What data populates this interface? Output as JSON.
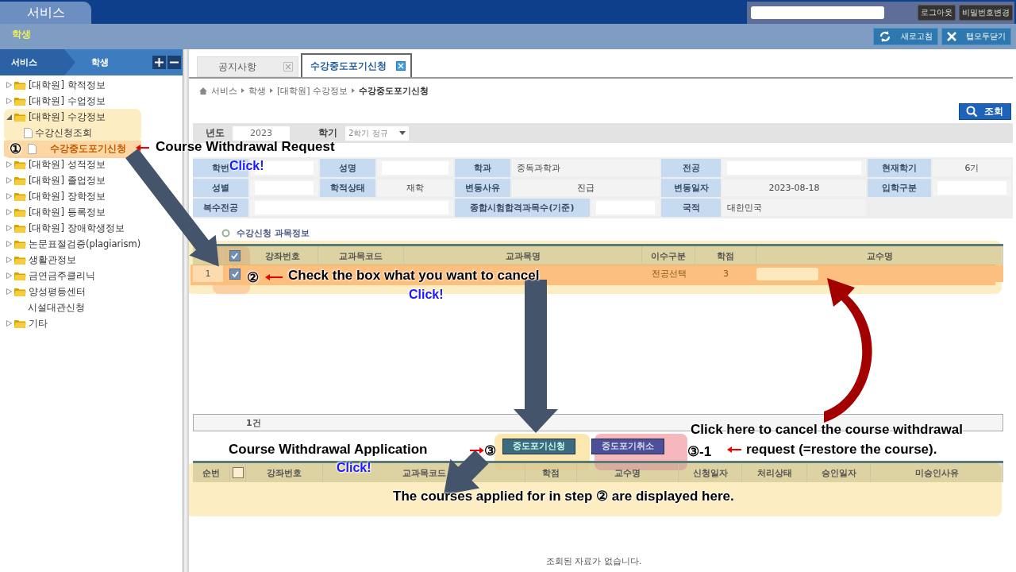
{
  "header": {
    "service_tab": "서비스",
    "buttons": [
      "로그아웃",
      "비밀번호변경"
    ]
  },
  "toolbar": {
    "title": "학생",
    "buttons": [
      {
        "label": "새로고침",
        "kind": "refresh"
      },
      {
        "label": "탭모두닫기",
        "kind": "close"
      }
    ]
  },
  "sidebar": {
    "path": [
      "서비스",
      "학생"
    ],
    "tree": [
      {
        "label": "[대학원] 학적정보",
        "kind": "folder",
        "expanded": false
      },
      {
        "label": "[대학원] 수업정보",
        "kind": "folder",
        "expanded": false
      },
      {
        "label": "[대학원] 수강정보",
        "kind": "folder",
        "expanded": true,
        "children": [
          {
            "label": "수강신청조회",
            "kind": "page",
            "selected": false
          },
          {
            "label": "수강중도포기신청",
            "kind": "page",
            "selected": true
          }
        ]
      },
      {
        "label": "[대학원] 성적정보",
        "kind": "folder",
        "expanded": false
      },
      {
        "label": "[대학원] 졸업정보",
        "kind": "folder",
        "expanded": false
      },
      {
        "label": "[대학원] 장학정보",
        "kind": "folder",
        "expanded": false
      },
      {
        "label": "[대학원] 등록정보",
        "kind": "folder",
        "expanded": false
      },
      {
        "label": "[대학원] 장애학생정보",
        "kind": "folder",
        "expanded": false
      },
      {
        "label": "논문표절검증(plagiarism)",
        "kind": "folder",
        "expanded": false
      },
      {
        "label": "생활관정보",
        "kind": "folder",
        "expanded": false
      },
      {
        "label": "금연금주클리닉",
        "kind": "folder",
        "expanded": false
      },
      {
        "label": "양성평등센터",
        "kind": "folder",
        "expanded": false
      },
      {
        "label": "시설대관신청",
        "kind": "plain"
      },
      {
        "label": "기타",
        "kind": "folder",
        "expanded": false
      }
    ]
  },
  "tabs": [
    {
      "label": "공지사항",
      "selected": false
    },
    {
      "label": "수강중도포기신청",
      "selected": true
    }
  ],
  "page": {
    "breadcrumb": [
      "서비스",
      "학생",
      "[대학원] 수강정보",
      "수강중도포기신청"
    ],
    "search_button": "조회",
    "filters": [
      {
        "label": "년도",
        "value": "2023",
        "kind": "text"
      },
      {
        "label": "학기",
        "value": "2학기 정규",
        "kind": "select"
      }
    ],
    "profile": [
      [
        {
          "label": "학번"
        },
        {
          "label": "성명"
        },
        {
          "label": "학과",
          "value": "중독과학과"
        },
        {
          "label": "전공"
        },
        {
          "label": "현재학기",
          "value": "6기"
        }
      ],
      [
        {
          "label": "성별"
        },
        {
          "label": "학적상태",
          "value": "재학"
        },
        {
          "label": "변동사유",
          "value": "진급"
        },
        {
          "label": "변동일자",
          "value": "2023-08-18"
        },
        {
          "label": "입학구분"
        }
      ],
      [
        {
          "label": "복수전공"
        },
        {
          "label": "종합시험합격과목수(기준)"
        },
        {
          "label": "국적",
          "value": "대한민국"
        }
      ]
    ],
    "courses": {
      "title": "수강신청 과목정보",
      "header_checked": true,
      "columns": [
        "강좌번호",
        "교과목코드",
        "교과목명",
        "이수구분",
        "학점",
        "교수명"
      ],
      "rows": [
        {
          "no": "1",
          "checked": true,
          "selected": true,
          "category": "전공선택",
          "credits": "3"
        }
      ],
      "count": "1건"
    },
    "actions": [
      "중도포기신청",
      "중도포기취소"
    ],
    "applied": {
      "header_checked": false,
      "columns": [
        "순번",
        "강좌번호",
        "교과목코드",
        "학점",
        "교수명",
        "신청일자",
        "처리상태",
        "승인일자",
        "미승인사유"
      ],
      "empty_message": "조회된 자료가 없습니다."
    }
  },
  "annotations": {
    "step1": {
      "marker": "①",
      "text": "Course Withdrawal Request",
      "hint": "Click!"
    },
    "step2": {
      "marker": "②",
      "text": "Check the box what you want to cancel",
      "hint": "Click!"
    },
    "step3": {
      "text": "Course Withdrawal Application",
      "marker": "③",
      "hint": "Click!"
    },
    "step3_1": {
      "marker": "③-1",
      "lines": [
        "Click here to cancel the course withdrawal",
        "request (=restore the course)."
      ]
    },
    "note": "The courses applied for in step ② are displayed here."
  }
}
